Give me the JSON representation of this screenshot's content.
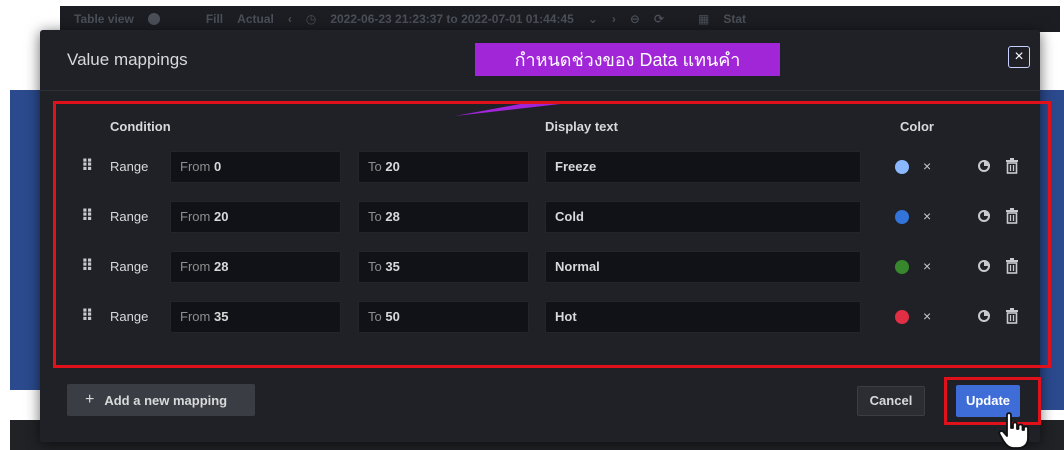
{
  "background": {
    "toolbar": {
      "table_view_label": "Table view",
      "fill_label": "Fill",
      "actual_label": "Actual",
      "time_range": "2022-06-23 21:23:37 to 2022-07-01 01:44:45",
      "panel_type": "Stat"
    }
  },
  "modal": {
    "title": "Value mappings",
    "close_label": "×",
    "columns": {
      "condition": "Condition",
      "display_text": "Display text",
      "color": "Color"
    },
    "mappings": [
      {
        "type": "Range",
        "from_prefix": "From",
        "from": "0",
        "to_prefix": "To",
        "to": "20",
        "display_text": "Freeze",
        "color": "#8ab8ff"
      },
      {
        "type": "Range",
        "from_prefix": "From",
        "from": "20",
        "to_prefix": "To",
        "to": "28",
        "display_text": "Cold",
        "color": "#3274d9"
      },
      {
        "type": "Range",
        "from_prefix": "From",
        "from": "28",
        "to_prefix": "To",
        "to": "35",
        "display_text": "Normal",
        "color": "#37872d"
      },
      {
        "type": "Range",
        "from_prefix": "From",
        "from": "35",
        "to_prefix": "To",
        "to": "50",
        "display_text": "Hot",
        "color": "#e02f44"
      }
    ],
    "add_mapping_label": "Add a new mapping",
    "cancel_label": "Cancel",
    "update_label": "Update"
  },
  "annotation": {
    "callout_text": "กำหนดช่วงของ Data แทนคำ",
    "callout_color": "#a026d8",
    "highlight_color": "#e0111b"
  }
}
